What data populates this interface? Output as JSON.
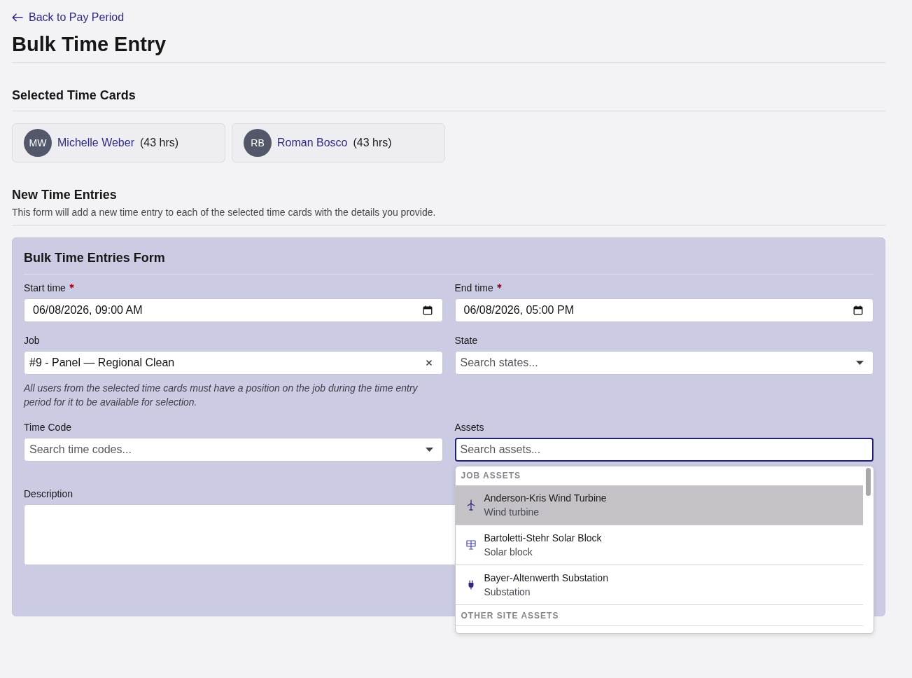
{
  "back_link": {
    "label": "Back to Pay Period"
  },
  "title": "Bulk Time Entry",
  "selected_time_cards": {
    "heading": "Selected Time Cards",
    "cards": [
      {
        "initials": "MW",
        "name": "Michelle Weber",
        "hours": "(43 hrs)"
      },
      {
        "initials": "RB",
        "name": "Roman Bosco",
        "hours": "(43 hrs)"
      }
    ]
  },
  "new_time_entries": {
    "heading": "New Time Entries",
    "description": "This form will add a new time entry to each of the selected time cards with the details you provide."
  },
  "form": {
    "title": "Bulk Time Entries Form",
    "fields": [
      {
        "kind": "datetime",
        "label": "Start time",
        "required": true,
        "value": "06/08/2026, 09:00 AM"
      },
      {
        "kind": "datetime",
        "label": "End time",
        "required": true,
        "value": "06/08/2026, 05:00 PM"
      },
      {
        "kind": "select",
        "label": "Job",
        "required": false,
        "value": "#9 - Panel — Regional Clean",
        "expanded": false,
        "hint": "All users from the selected time cards must have a position on the job during the time entry period for it to be available for selection."
      },
      {
        "kind": "select",
        "label": "State",
        "required": false,
        "placeholder": "Search states...",
        "expanded": false
      },
      {
        "kind": "select",
        "label": "Time Code",
        "required": false,
        "placeholder": "Search time codes...",
        "expanded": false
      },
      {
        "kind": "select",
        "label": "Assets",
        "required": false,
        "placeholder": "Search assets...",
        "expanded": true,
        "menu": {
          "groups": [
            {
              "label": "JOB ASSETS",
              "options": [
                {
                  "kind": "wind_turbine",
                  "title": "Anderson-Kris Wind Turbine",
                  "subtitle": "Wind turbine",
                  "selected": true
                },
                {
                  "kind": "solar_block",
                  "title": "Bartoletti-Stehr Solar Block",
                  "subtitle": "Solar block",
                  "selected": false
                },
                {
                  "kind": "substation",
                  "title": "Bayer-Altenwerth Substation",
                  "subtitle": "Substation",
                  "selected": false
                }
              ]
            },
            {
              "label": "OTHER SITE ASSETS"
            }
          ]
        }
      },
      {
        "kind": "textarea",
        "label": "Description",
        "required": false
      }
    ]
  }
}
